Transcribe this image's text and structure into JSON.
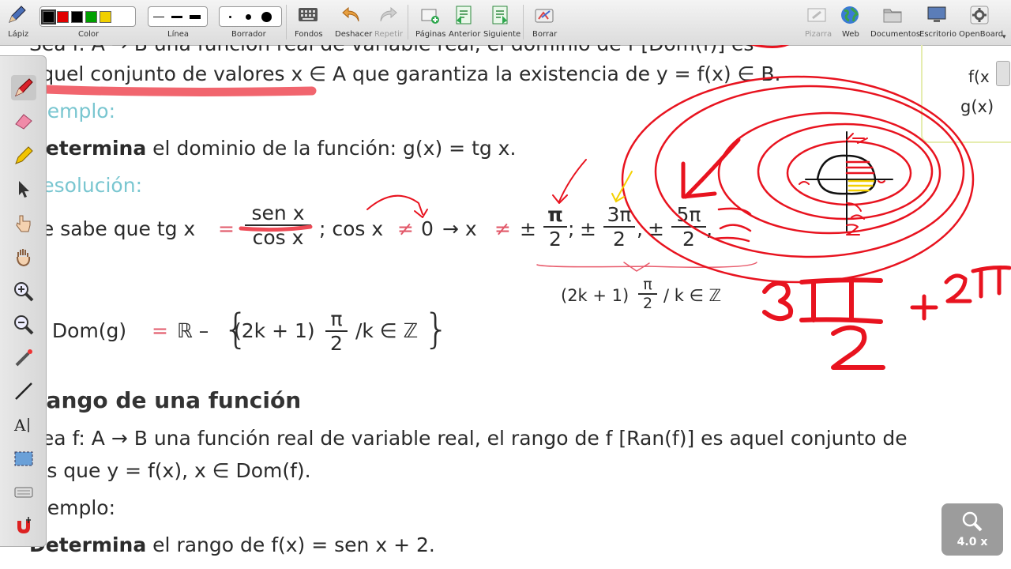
{
  "toolbar": {
    "pen_label": "Lápiz",
    "color_label": "Color",
    "line_label": "Línea",
    "eraser_label": "Borrador",
    "backgrounds_label": "Fondos",
    "undo_label": "Deshacer",
    "redo_label": "Repetir",
    "pages_label": "Páginas",
    "previous_label": "Anterior",
    "next_label": "Siguiente",
    "clear_label": "Borrar",
    "board_label": "Pizarra",
    "web_label": "Web",
    "documents_label": "Documentos",
    "desktop_label": "Escritorio",
    "openboard_label": "OpenBoard",
    "colors": [
      "#000000",
      "#e00000",
      "#000000",
      "#00a000",
      "#f0d000"
    ]
  },
  "content": {
    "def_line1": "Sea f: A → B una función real de variable real, el dominio de f [Dom(f)] es",
    "def_line2": "aquel conjunto de valores x ∈ A que garantiza la existencia de y = f(x) ∈ B.",
    "example1_label": "Ejemplo:",
    "example1_bold": "Determina",
    "example1_rest": " el dominio de la función: g(x) = tg x.",
    "resolution_label": "Resolución:",
    "sabe_pre": "Se sabe que tg x",
    "eq": "=",
    "frac_num": "sen x",
    "frac_den": "cos x",
    "cos_part": "; cos x",
    "neq": "≠",
    "zero": "0",
    "arrow_x": "→ x",
    "pm": "±",
    "pi": "π",
    "two": "2",
    "three_pi": "3π",
    "five_pi": "5π",
    "sep1": ";",
    "sep2": ",",
    "pm2": "±",
    "pm3": "±",
    "general_pre": "(2k + 1)",
    "general_post": "/ k ∈ ℤ",
    "dom_pre": "→ Dom(g)",
    "dom_r": "ℝ –",
    "dom_set_pre": "(2k + 1)",
    "dom_set_post": "/k ∈ ℤ",
    "range_heading": "Rango de una función",
    "range_line1": "Sea f: A → B una función real de variable real, el rango de f [Ran(f)] es aquel conjunto de",
    "range_line2": "les que y = f(x), x ∈ Dom(f).",
    "example2_label": "Ejemplo:",
    "example2_bold": "Determina",
    "example2_rest": " el rango de f(x) = sen x + 2.",
    "side_top": "f(x",
    "side_bottom": "g(x)"
  },
  "zoom": {
    "label": "4.0 x"
  },
  "ink_color": "#e8131f",
  "highlight_yellow": "#f4d000"
}
